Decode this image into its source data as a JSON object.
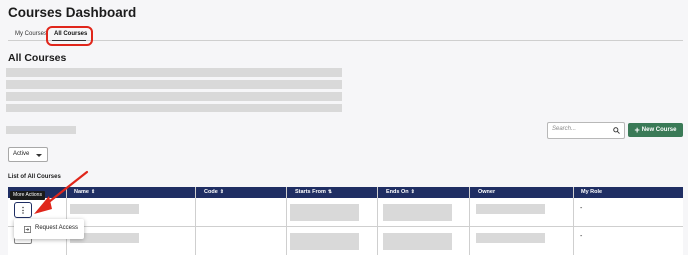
{
  "header": {
    "title": "Courses Dashboard"
  },
  "tabs": [
    {
      "label": "My Courses",
      "active": false
    },
    {
      "label": "All Courses",
      "active": true
    }
  ],
  "section": {
    "title": "All Courses"
  },
  "search": {
    "placeholder": "Search..."
  },
  "new_course_button": {
    "label": "New Course"
  },
  "status_filter": {
    "value": "Active"
  },
  "list": {
    "title": "List of All Courses"
  },
  "table": {
    "columns": [
      {
        "label": "Name",
        "sort_icon": "⇕"
      },
      {
        "label": "Code",
        "sort_icon": "⇕"
      },
      {
        "label": "Starts From",
        "sort_icon": "⇅"
      },
      {
        "label": "Ends On",
        "sort_icon": "⇕"
      },
      {
        "label": "Owner",
        "sort_icon": ""
      },
      {
        "label": "My Role",
        "sort_icon": ""
      }
    ],
    "rows": [
      {
        "my_role": "-"
      },
      {
        "my_role": "-"
      }
    ]
  },
  "more_actions": {
    "tooltip": "More Actions",
    "kebab_glyph": "⋮"
  },
  "menu": {
    "items": [
      {
        "label": "Request Access",
        "icon": "request-access-icon"
      }
    ]
  },
  "colors": {
    "accent": "#1f2e63",
    "primary_button": "#3a7a57",
    "annotation": "#e0261b"
  }
}
